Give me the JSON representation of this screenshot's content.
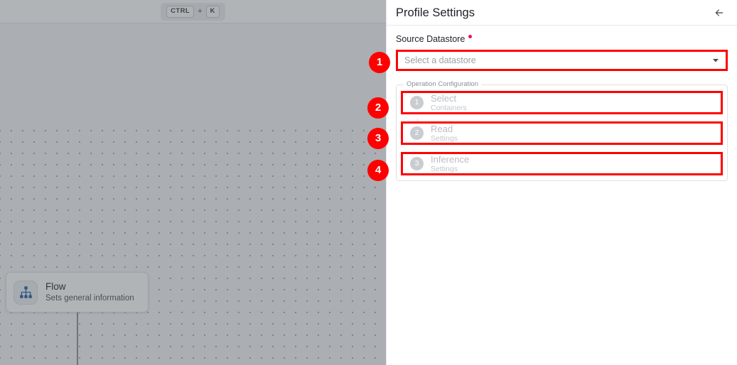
{
  "canvas": {
    "shortcut": {
      "modifier_key": "CTRL",
      "plus": "+",
      "action_key": "K"
    },
    "flow_node": {
      "icon": "hierarchy-icon",
      "title": "Flow",
      "subtitle": "Sets general information"
    }
  },
  "panel": {
    "title": "Profile Settings",
    "back_icon": "arrow-left-icon",
    "datastore_field": {
      "label": "Source Datastore",
      "required_indicator": "•",
      "placeholder": "Select a datastore",
      "value": "",
      "caret_icon": "chevron-down-icon"
    },
    "operation_config": {
      "legend": "Operation Configuration",
      "steps": [
        {
          "number": "1",
          "title": "Select",
          "subtitle": "Containers"
        },
        {
          "number": "2",
          "title": "Read",
          "subtitle": "Settings"
        },
        {
          "number": "3",
          "title": "Inference",
          "subtitle": "Settings"
        }
      ]
    }
  },
  "annotations": {
    "badges": [
      {
        "label": "1"
      },
      {
        "label": "2"
      },
      {
        "label": "3"
      },
      {
        "label": "4"
      }
    ]
  },
  "colors": {
    "annotation_red": "#ff0000",
    "required_pink": "#e31b54",
    "flow_icon_blue": "#1f5fa8",
    "step_circle_gray": "#c9ccd0"
  }
}
